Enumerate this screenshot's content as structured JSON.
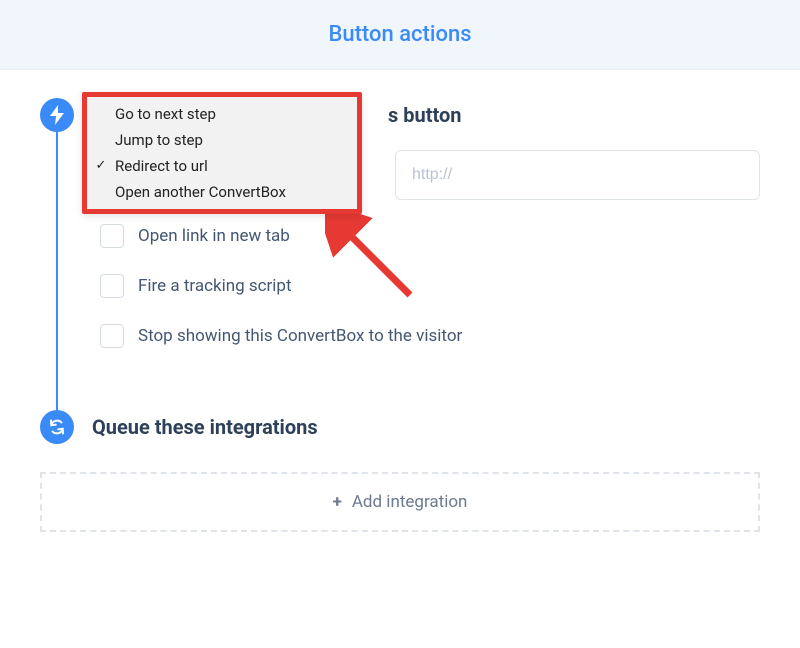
{
  "header": {
    "title": "Button actions"
  },
  "section1": {
    "title_visible_fragment": "s button",
    "url_placeholder": "http://"
  },
  "dropdown": {
    "items": [
      {
        "label": "Go to next step",
        "selected": false
      },
      {
        "label": "Jump to step",
        "selected": false
      },
      {
        "label": "Redirect to url",
        "selected": true
      },
      {
        "label": "Open another ConvertBox",
        "selected": false
      }
    ]
  },
  "checkboxes": {
    "open_new_tab": "Open link in new tab",
    "fire_script": "Fire a tracking script",
    "stop_showing": "Stop showing this ConvertBox to the visitor"
  },
  "section2": {
    "title": "Queue these integrations"
  },
  "add_integration": {
    "label": "Add integration",
    "plus": "+"
  }
}
